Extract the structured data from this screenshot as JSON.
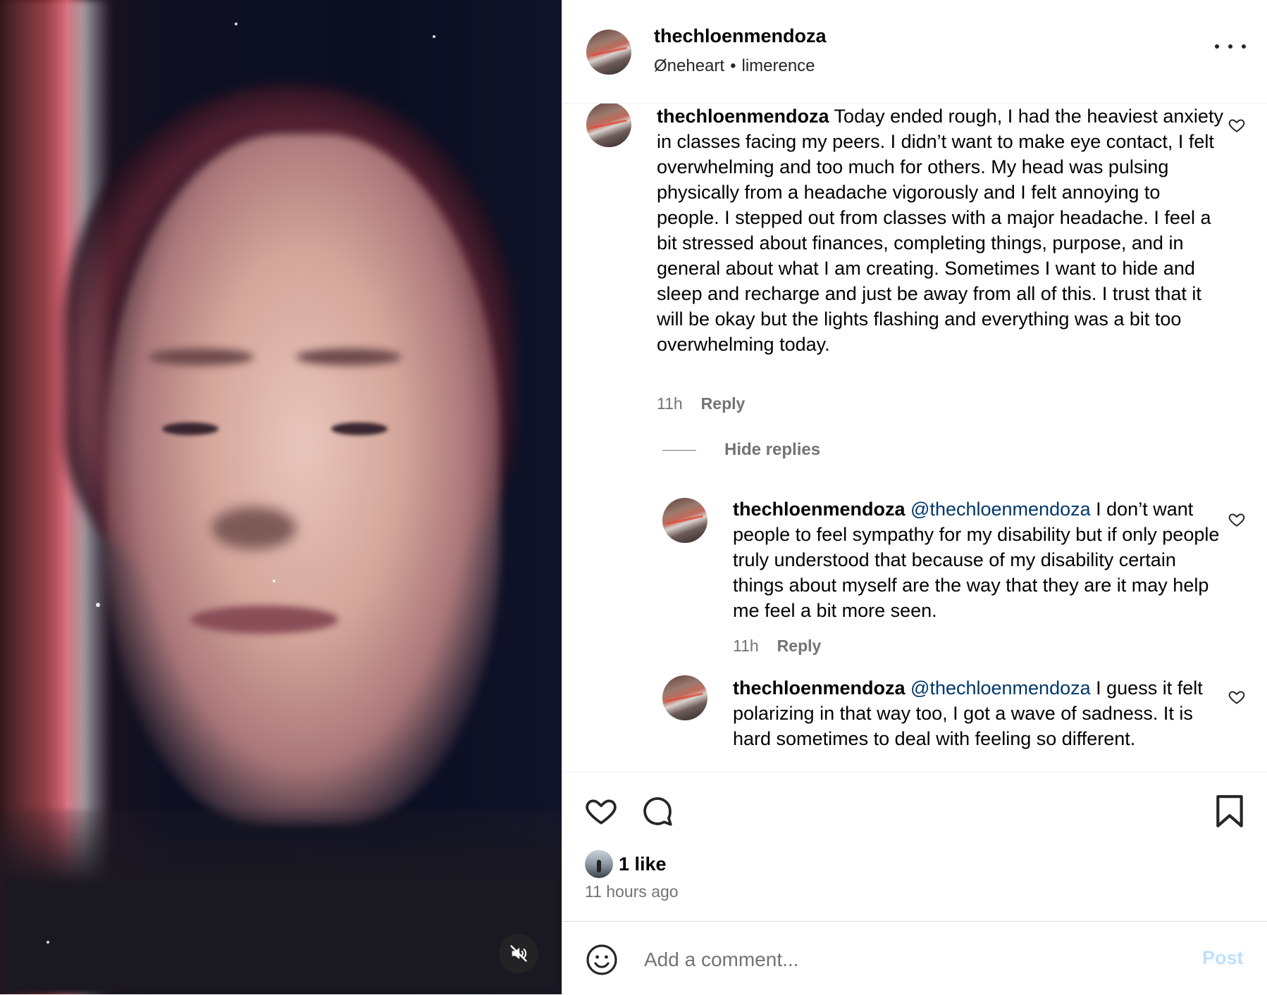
{
  "post": {
    "username": "thechloenmendoza",
    "audio_artist": "Øneheart",
    "audio_track": "limerence",
    "audio_separator": "•"
  },
  "comments": [
    {
      "username": "thechloenmendoza",
      "text": "Today ended rough, I had the heaviest anxiety in classes facing my peers. I didn’t want to make eye contact, I felt overwhelming and too much for others. My head was pulsing physically from a headache vigorously and I felt annoying to people. I stepped out from classes with a major headache. I feel a bit stressed about finances, completing things, purpose, and in general about what I am creating. Sometimes I want to hide and sleep and recharge and just be away from all of this. I trust that it will be okay but the lights flashing and everything was a bit too overwhelming today.",
      "time": "11h",
      "reply_label": "Reply"
    }
  ],
  "hide_replies_label": "Hide replies",
  "replies": [
    {
      "username": "thechloenmendoza",
      "mention": "@thechloenmendoza",
      "text": "I don’t want people to feel sympathy for my disability but if only people truly understood that because of my disability certain things about myself are the way that they are it may help me feel a bit more seen.",
      "time": "11h",
      "reply_label": "Reply"
    },
    {
      "username": "thechloenmendoza",
      "mention": "@thechloenmendoza",
      "text": "I guess it felt polarizing in that way too, I got a wave of sadness. It is hard sometimes to deal with feeling so different."
    }
  ],
  "likes": {
    "count_text": "1 like",
    "time_ago": "11 hours ago"
  },
  "composer": {
    "placeholder": "Add a comment...",
    "post_label": "Post"
  },
  "icons": {
    "mute": "speaker-muted-icon",
    "more": "more-options-icon",
    "like": "heart-icon",
    "comment": "comment-bubble-icon",
    "save": "bookmark-icon",
    "emoji": "emoji-icon"
  },
  "colors": {
    "mention": "#00376b",
    "meta_text": "#737373",
    "post_disabled": "#c0dffd"
  }
}
